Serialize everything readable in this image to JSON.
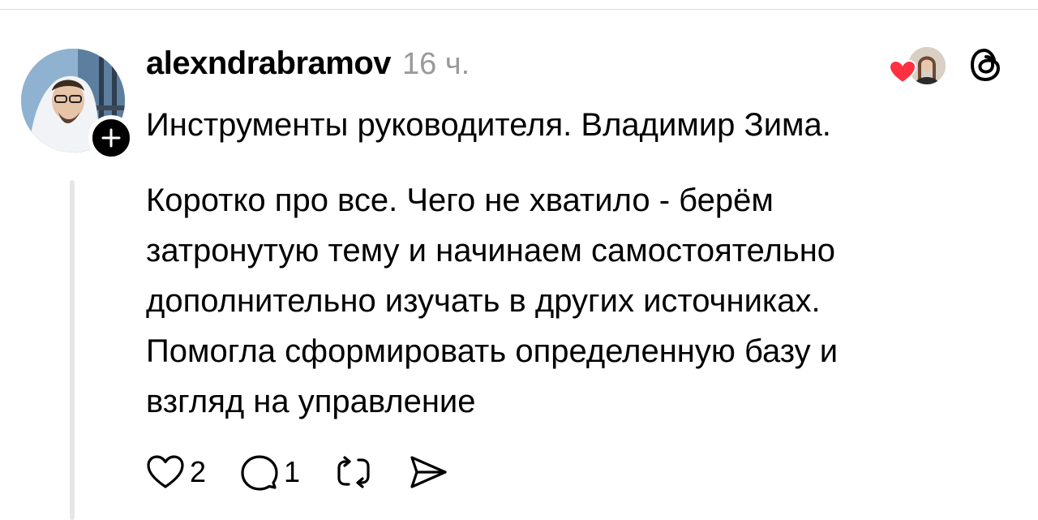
{
  "post": {
    "username": "alexndrabramov",
    "time": "16 ч.",
    "title": "Инструменты руководителя. Владимир Зима.",
    "body": "Коротко про все. Чего не хватило - берём\nзатронутую тему и начинаем самостоятельно\nдополнительно изучать в других источниках.\nПомогла сформировать определенную базу и\nвзгляд на управление"
  },
  "actions": {
    "likes_count": "2",
    "comments_count": "1"
  },
  "icons": {
    "like": "heart-outline-icon",
    "comment": "comment-bubble-icon",
    "repost": "repost-icon",
    "share": "send-icon",
    "threads": "threads-logo-icon",
    "follow": "plus-icon",
    "liked_by": "heart-filled-icon"
  },
  "colors": {
    "text": "#000000",
    "muted": "#9a9a9a",
    "heart": "#ff3040",
    "divider": "#e6e6e6"
  }
}
